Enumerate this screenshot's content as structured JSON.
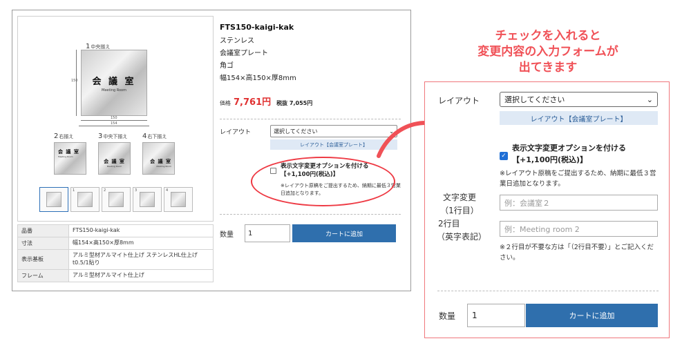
{
  "product": {
    "code": "FTS150-kaigi-kak",
    "material": "ステンレス",
    "type": "会議室プレート",
    "shape": "角ゴ",
    "size": "幅154×高150×厚8mm",
    "price_label": "価格",
    "price": "7,761円",
    "price_tax_excl": "税抜 7,055円"
  },
  "gallery": {
    "main_label_num": "1",
    "main_label": "中央揃え",
    "plate_title": "会 議 室",
    "plate_sub": "Meeting Room",
    "dim_inner_w": "150",
    "dim_outer_w": "154",
    "dim_h": "150",
    "variants": [
      {
        "num": "2",
        "label": "右揃え"
      },
      {
        "num": "3",
        "label": "中央下揃え"
      },
      {
        "num": "4",
        "label": "右下揃え"
      }
    ],
    "thumb_nums": [
      "",
      "1",
      "2",
      "3",
      "4"
    ]
  },
  "specs": [
    {
      "key": "品番",
      "value": "FTS150-kaigi-kak"
    },
    {
      "key": "寸法",
      "value": "幅154×高150×厚8mm"
    },
    {
      "key": "表示基板",
      "value": "アルミ型材アルマイト仕上げ ステンレスHL仕上げt0.5/1貼り"
    },
    {
      "key": "フレーム",
      "value": "アルミ型材アルマイト仕上げ"
    }
  ],
  "form_small": {
    "layout_label": "レイアウト",
    "layout_select": "選択してください",
    "layout_link": "レイアウト【会議室プレート】",
    "option_label_1": "表示文字変更オプションを付ける",
    "option_label_2": "【+1,100円(税込)】",
    "option_note": "※レイアウト原稿をご提出するため、納期に最低３営業日追加となります。",
    "qty_label": "数量",
    "qty_value": "1",
    "cart_button": "カートに追加"
  },
  "callout": {
    "line1": "チェックを入れると",
    "line2": "変更内容の入力フォームが",
    "line3": "出てきます"
  },
  "form_zoom": {
    "layout_label": "レイアウト",
    "layout_select": "選択してください",
    "layout_link": "レイアウト【会議室プレート】",
    "option_checked": true,
    "option_label_1": "表示文字変更オプションを付ける",
    "option_label_2": "【+1,100円(税込)】",
    "option_note": "※レイアウト原稿をご提出するため、納期に最低３営業日追加となります。",
    "text_change_label_1": "文字変更",
    "text_change_label_2": "（1行目）",
    "line2_label_1": "2行目",
    "line2_label_2": "（英字表記）",
    "line1_placeholder": "例：会議室２",
    "line2_placeholder": "例：Meeting room 2",
    "line2_note": "※２行目が不要な方は「（2行目不要）」とご記入ください。",
    "qty_label": "数量",
    "qty_value": "1",
    "cart_button": "カートに追加"
  },
  "colors": {
    "accent_red": "#f05157",
    "price_red": "#e03131",
    "button_blue": "#2f6fad",
    "link_bg": "#dfe9f5",
    "checkbox_blue": "#1f6fd6"
  },
  "icons": {
    "dropdown": "chevron-down-icon",
    "arrow": "curved-arrow-icon"
  }
}
